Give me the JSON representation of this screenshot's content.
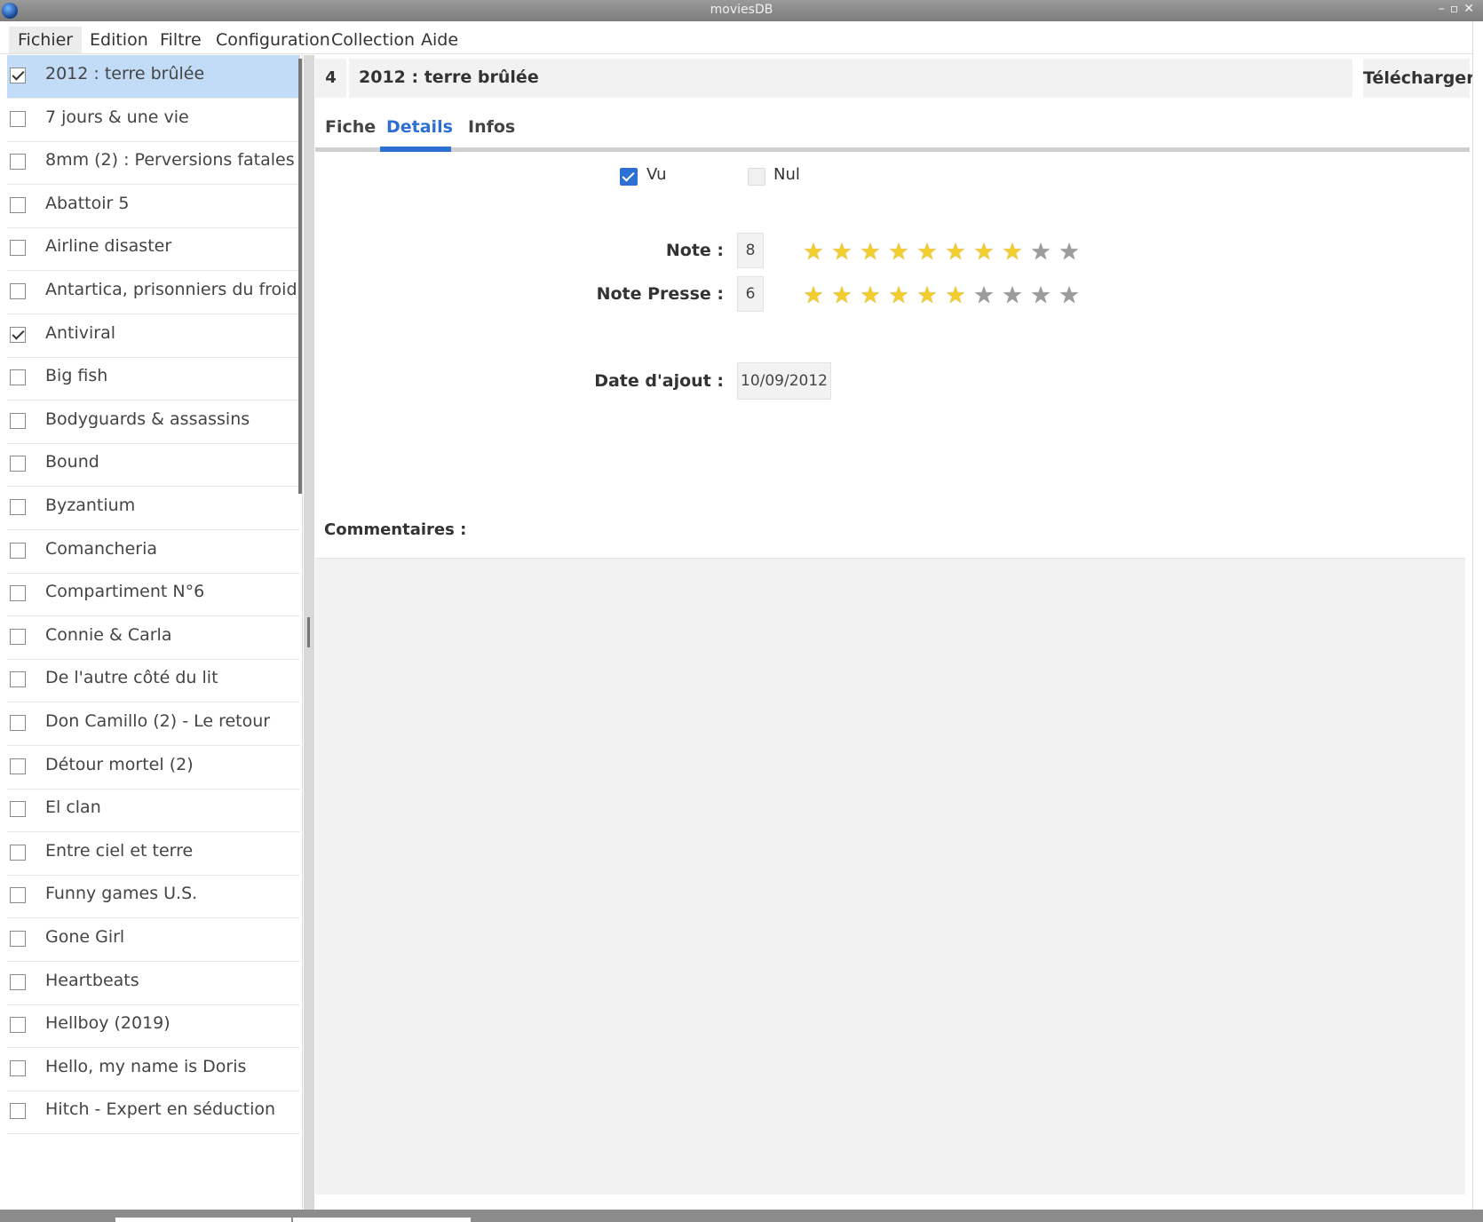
{
  "window": {
    "title": "moviesDB"
  },
  "menu": [
    "Fichier",
    "Edition",
    "Filtre",
    "Configuration",
    "Collection",
    "Aide"
  ],
  "movies": [
    {
      "title": "2012 : terre brûlée",
      "checked": true,
      "selected": true
    },
    {
      "title": "7 jours & une vie",
      "checked": false
    },
    {
      "title": "8mm (2) : Perversions fatales",
      "checked": false
    },
    {
      "title": "Abattoir 5",
      "checked": false
    },
    {
      "title": "Airline disaster",
      "checked": false
    },
    {
      "title": "Antartica, prisonniers du froid",
      "checked": false
    },
    {
      "title": "Antiviral",
      "checked": true
    },
    {
      "title": "Big fish",
      "checked": false
    },
    {
      "title": "Bodyguards & assassins",
      "checked": false
    },
    {
      "title": "Bound",
      "checked": false
    },
    {
      "title": "Byzantium",
      "checked": false
    },
    {
      "title": "Comancheria",
      "checked": false
    },
    {
      "title": "Compartiment N°6",
      "checked": false
    },
    {
      "title": "Connie & Carla",
      "checked": false
    },
    {
      "title": "De l'autre côté du lit",
      "checked": false
    },
    {
      "title": "Don Camillo (2) - Le retour",
      "checked": false
    },
    {
      "title": "Détour mortel (2)",
      "checked": false
    },
    {
      "title": "El clan",
      "checked": false
    },
    {
      "title": "Entre ciel et terre",
      "checked": false
    },
    {
      "title": "Funny games U.S.",
      "checked": false
    },
    {
      "title": "Gone Girl",
      "checked": false
    },
    {
      "title": "Heartbeats",
      "checked": false
    },
    {
      "title": "Hellboy (2019)",
      "checked": false
    },
    {
      "title": "Hello, my name is Doris",
      "checked": false
    },
    {
      "title": "Hitch - Expert en séduction",
      "checked": false
    }
  ],
  "detail": {
    "id": "4",
    "title": "2012 : terre brûlée",
    "download_label": "Télécharger",
    "tabs": [
      "Fiche",
      "Details",
      "Infos"
    ],
    "active_tab": "Details",
    "vu_label": "Vu",
    "vu_checked": true,
    "nul_label": "Nul",
    "nul_checked": false,
    "note_label": "Note :",
    "note_value": "8",
    "note_presse_label": "Note Presse :",
    "note_presse_value": "6",
    "stars_max": 10,
    "date_label": "Date d'ajout :",
    "date_value": "10/09/2012",
    "comments_label": "Commentaires :"
  },
  "colors": {
    "accent": "#2d6fd3",
    "selection": "#c2dbf6",
    "star_on": "#f3cd2c",
    "star_off": "#9c9c9c"
  },
  "icons": [
    "app-icon",
    "minimize-icon",
    "restore-icon",
    "close-icon",
    "star-icon"
  ]
}
